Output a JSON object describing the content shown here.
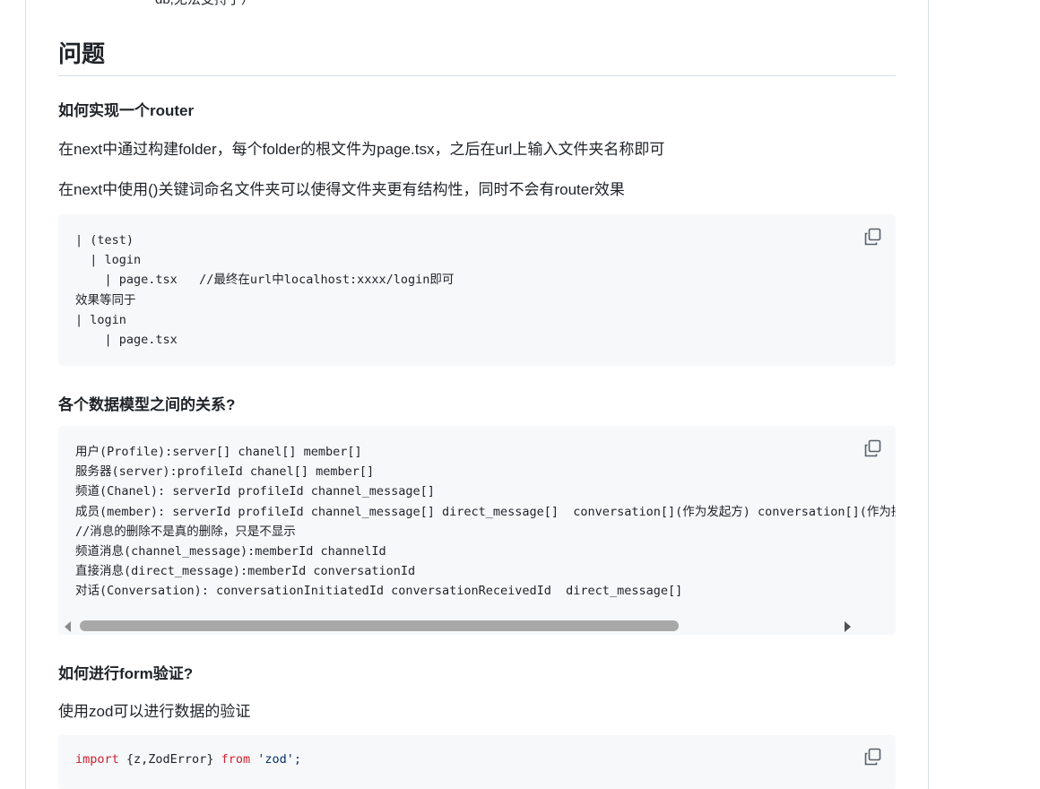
{
  "prev_line": "db,无法支持了）",
  "section_title": "问题",
  "q1": {
    "title": "如何实现一个router",
    "p1": "在next中通过构建folder，每个folder的根文件为page.tsx，之后在url上输入文件夹名称即可",
    "p2": "在next中使用()关键词命名文件夹可以使得文件夹更有结构性，同时不会有router效果",
    "code": "| (test)\n  | login\n    | page.tsx   //最终在url中localhost:xxxx/login即可\n效果等同于\n| login\n    | page.tsx"
  },
  "q2": {
    "title": "各个数据模型之间的关系?",
    "code": "用户(Profile):server[] chanel[] member[]\n服务器(server):profileId chanel[] member[]\n频道(Chanel): serverId profileId channel_message[]\n成员(member): serverId profileId channel_message[] direct_message[]  conversation[](作为发起方) conversation[](作为接收方)\n//消息的删除不是真的删除，只是不显示\n频道消息(channel_message):memberId channelId\n直接消息(direct_message):memberId conversationId\n对话(Conversation): conversationInitiatedId conversationReceivedId  direct_message[]",
    "scroll_fraction": 0.795
  },
  "q3": {
    "title": "如何进行form验证?",
    "p1": "使用zod可以进行数据的验证",
    "code_kw": "import",
    "code_rest": " {z,ZodError} ",
    "code_from": "from",
    "code_str": " 'zod';"
  },
  "icons": {
    "copy": "copy-icon",
    "scroll_left": "scroll-left-arrow-icon",
    "scroll_right": "scroll-right-arrow-icon"
  }
}
